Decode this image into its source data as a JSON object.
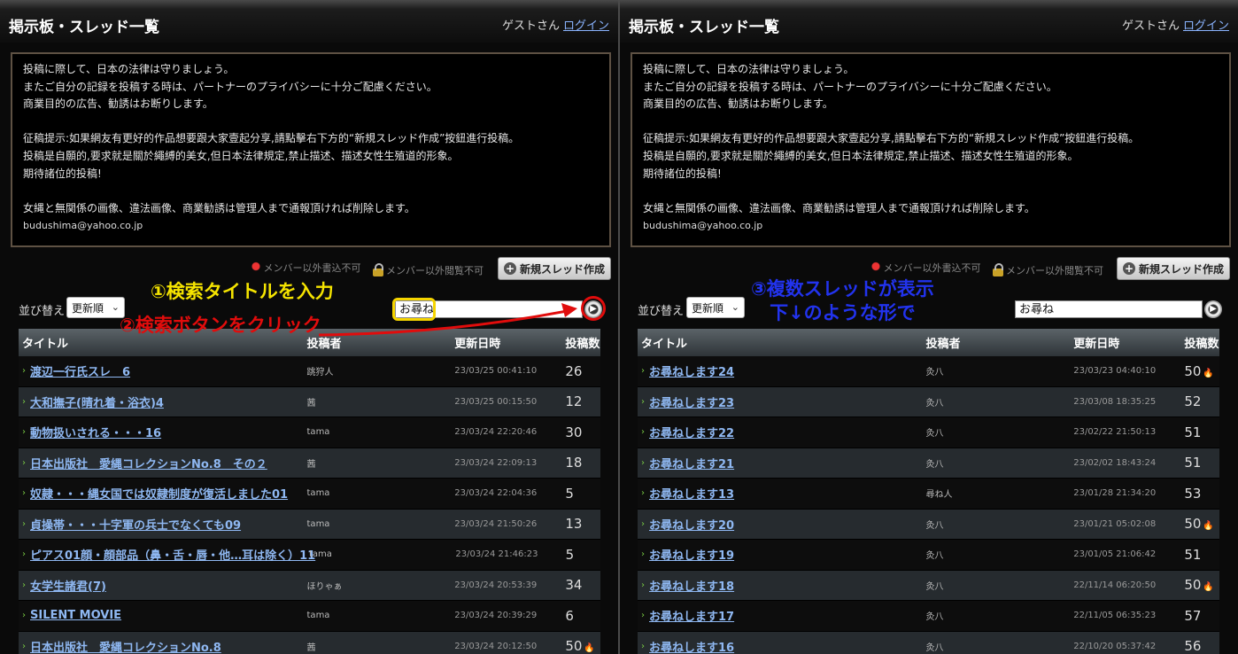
{
  "left": {
    "page_title": "掲示板・スレッド一覧",
    "guest_label": "ゲストさん",
    "login_label": "ログイン",
    "notice_lines": [
      "投稿に際して、日本の法律は守りましょう。",
      "またご自分の記録を投稿する時は、パートナーのプライバシーに十分ご配慮ください。",
      "商業目的の広告、勧誘はお断りします。",
      "",
      "征稿提示:如果網友有更好的作品想要跟大家壹起分享,請點擊右下方的“新規スレッド作成”按鈕進行投稿。",
      "投稿是自願的,要求就是關於繩縛的美女,但日本法律規定,禁止描述、描述女性生殖道的形象。",
      "期待諸位的投稿!",
      "",
      "女縄と無関係の画像、違法画像、商業勧誘は管理人まで通報頂ければ削除します。"
    ],
    "notice_email": "budushima@yahoo.co.jp",
    "status_write": "メンバー以外書込不可",
    "status_view": "メンバー以外閲覧不可",
    "new_thread_label": "新規スレッド作成",
    "sort_label": "並び替え",
    "sort_value": "更新順",
    "search_value": "お尋ね",
    "headers": {
      "title": "タイトル",
      "author": "投稿者",
      "date": "更新日時",
      "count": "投稿数"
    },
    "rows": [
      {
        "title": "渡辺一行氏スレ　6",
        "author": "跳狩人",
        "date": "23/03/25 00:41:10",
        "count": "26",
        "hot": ""
      },
      {
        "title": "大和撫子(晴れ着・浴衣)4",
        "author": "茜",
        "date": "23/03/25 00:15:50",
        "count": "12",
        "hot": ""
      },
      {
        "title": "動物扱いされる・・・16",
        "author": "tama",
        "date": "23/03/24 22:20:46",
        "count": "30",
        "hot": ""
      },
      {
        "title": "日本出版社　愛縄コレクションNo.8　その２",
        "author": "茜",
        "date": "23/03/24 22:09:13",
        "count": "18",
        "hot": ""
      },
      {
        "title": "奴隷・・・縄女国では奴隷制度が復活しました01",
        "author": "tama",
        "date": "23/03/24 22:04:36",
        "count": "5",
        "hot": ""
      },
      {
        "title": "貞操帯・・・十字軍の兵士でなくても09",
        "author": "tama",
        "date": "23/03/24 21:50:26",
        "count": "13",
        "hot": ""
      },
      {
        "title": "ピアス01顔・顔部品（鼻・舌・唇・他…耳は除く）11",
        "author": "tama",
        "date": "23/03/24 21:46:23",
        "count": "5",
        "hot": ""
      },
      {
        "title": "女学生諸君(7)",
        "author": "ほりゃぁ",
        "date": "23/03/24 20:53:39",
        "count": "34",
        "hot": ""
      },
      {
        "title": "SILENT MOVIE",
        "author": "tama",
        "date": "23/03/24 20:39:29",
        "count": "6",
        "hot": ""
      },
      {
        "title": "日本出版社　愛縄コレクションNo.8",
        "author": "茜",
        "date": "23/03/24 20:12:50",
        "count": "50",
        "hot": "🔥"
      }
    ]
  },
  "right": {
    "page_title": "掲示板・スレッド一覧",
    "guest_label": "ゲストさん",
    "login_label": "ログイン",
    "notice_lines": [
      "投稿に際して、日本の法律は守りましょう。",
      "またご自分の記録を投稿する時は、パートナーのプライバシーに十分ご配慮ください。",
      "商業目的の広告、勧誘はお断りします。",
      "",
      "征稿提示:如果網友有更好的作品想要跟大家壹起分享,請點擊右下方的“新規スレッド作成”按鈕進行投稿。",
      "投稿是自願的,要求就是關於繩縛的美女,但日本法律規定,禁止描述、描述女性生殖道的形象。",
      "期待諸位的投稿!",
      "",
      "女縄と無関係の画像、違法画像、商業勧誘は管理人まで通報頂ければ削除します。"
    ],
    "notice_email": "budushima@yahoo.co.jp",
    "status_write": "メンバー以外書込不可",
    "status_view": "メンバー以外閲覧不可",
    "new_thread_label": "新規スレッド作成",
    "sort_label": "並び替え",
    "sort_value": "更新順",
    "search_value": "お尋ね",
    "headers": {
      "title": "タイトル",
      "author": "投稿者",
      "date": "更新日時",
      "count": "投稿数"
    },
    "rows": [
      {
        "title": "お尋ねします24",
        "author": "灸八",
        "date": "23/03/23 04:40:10",
        "count": "50",
        "hot": "🔥"
      },
      {
        "title": "お尋ねします23",
        "author": "灸八",
        "date": "23/03/08 18:35:25",
        "count": "52",
        "hot": ""
      },
      {
        "title": "お尋ねします22",
        "author": "灸八",
        "date": "23/02/22 21:50:13",
        "count": "51",
        "hot": ""
      },
      {
        "title": "お尋ねします21",
        "author": "灸八",
        "date": "23/02/02 18:43:24",
        "count": "51",
        "hot": ""
      },
      {
        "title": "お尋ねします13",
        "author": "尋ね人",
        "date": "23/01/28 21:34:20",
        "count": "53",
        "hot": ""
      },
      {
        "title": "お尋ねします20",
        "author": "灸八",
        "date": "23/01/21 05:02:08",
        "count": "50",
        "hot": "🔥"
      },
      {
        "title": "お尋ねします19",
        "author": "灸八",
        "date": "23/01/05 21:06:42",
        "count": "51",
        "hot": ""
      },
      {
        "title": "お尋ねします18",
        "author": "灸八",
        "date": "22/11/14 06:20:50",
        "count": "50",
        "hot": "🔥"
      },
      {
        "title": "お尋ねします17",
        "author": "灸八",
        "date": "22/11/05 06:35:23",
        "count": "57",
        "hot": ""
      },
      {
        "title": "お尋ねします16",
        "author": "灸八",
        "date": "22/10/20 05:37:42",
        "count": "56",
        "hot": ""
      }
    ]
  },
  "annotations": {
    "step1": "①検索タイトルを入力",
    "step2": "②検索ボタンをクリック",
    "step3_line1": "③複数スレッドが表示",
    "step3_line2": "下↓のような形で",
    "colors": {
      "yellow": "#f5e400",
      "red": "#e10c0c",
      "blue": "#2233ee"
    }
  }
}
